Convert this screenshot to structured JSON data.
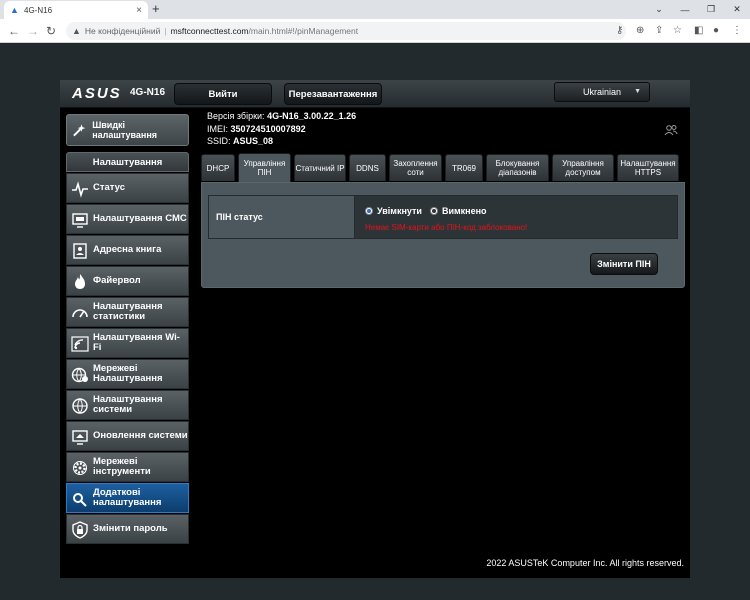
{
  "browser": {
    "tab_title": "4G-N16",
    "new_tab": "+",
    "security_label": "Не конфіденційний",
    "url_host": "msftconnecttest.com",
    "url_path": "/main.html#!/pinManagement"
  },
  "router": {
    "logo": "ASUS",
    "model": "4G-N16",
    "top_buttons": {
      "logout": "Вийти",
      "reboot": "Перезавантаження"
    },
    "language": "Ukrainian",
    "quick_setup": "Швидкі налаштування",
    "info": {
      "firmware_label": "Версія збірки:",
      "firmware_value": "4G-N16_3.00.22_1.26",
      "imei_label": "IMEI:",
      "imei_value": "350724510007892",
      "ssid_label": "SSID:",
      "ssid_value": "ASUS_08"
    },
    "sidebar": {
      "title": "Налаштування",
      "items": [
        {
          "label": "Статус"
        },
        {
          "label": "Налаштування СМС"
        },
        {
          "label": "Адресна книга"
        },
        {
          "label": "Файервол"
        },
        {
          "label": "Налаштування статистики"
        },
        {
          "label": "Налаштування Wi-Fi"
        },
        {
          "label": "Мережеві Налаштування"
        },
        {
          "label": "Налаштування системи"
        },
        {
          "label": "Оновлення системи"
        },
        {
          "label": "Мережеві інструменти"
        },
        {
          "label": "Додаткові налаштування"
        },
        {
          "label": "Змінити пароль"
        }
      ]
    },
    "tabs": [
      {
        "label": "DHCP"
      },
      {
        "label": "Управління ПІН"
      },
      {
        "label": "Статичний IP"
      },
      {
        "label": "DDNS"
      },
      {
        "label": "Захоплення соти"
      },
      {
        "label": "TR069"
      },
      {
        "label": "Блокування діапазонів"
      },
      {
        "label": "Управління доступом"
      },
      {
        "label": "Налаштування HTTPS"
      }
    ],
    "pin": {
      "status_label": "ПІН статус",
      "option_on": "Увімкнути",
      "option_off": "Вимкнено",
      "error": "Немає SIM-карти або ПІН-код заблоковано!",
      "change_button": "Змінити ПІН"
    },
    "footer": "2022 ASUSTeK Computer Inc. All rights reserved."
  },
  "colors": {
    "accent": "#0d3d6e",
    "error": "#e0141a",
    "panel": "#4d585e"
  }
}
